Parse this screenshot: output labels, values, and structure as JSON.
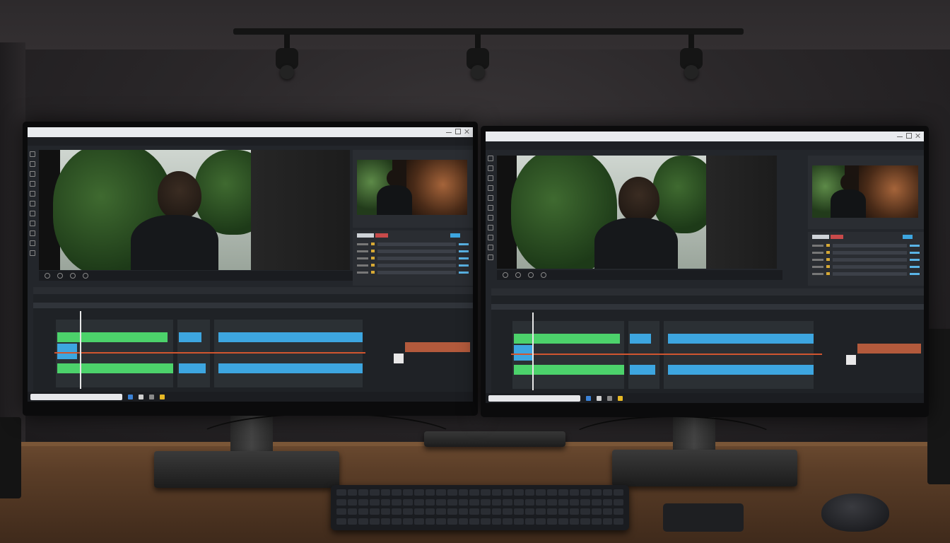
{
  "scene": {
    "description_labels": []
  },
  "monitors": [
    {
      "id": "left",
      "window_title": "",
      "menu": [
        "",
        "",
        "",
        "",
        "",
        ""
      ],
      "panel_tab": "",
      "colors": {
        "green_track": "#4cd26b",
        "blue_track": "#3da6e0",
        "red_line": "#d0552f",
        "accent_yellow": "#d7a935"
      }
    },
    {
      "id": "right",
      "window_title": "",
      "menu": [
        "",
        "",
        "",
        "",
        "",
        ""
      ],
      "panel_tab": "",
      "colors": {
        "green_track": "#4cd26b",
        "blue_track": "#3da6e0",
        "red_line": "#d0552f",
        "accent_yellow": "#d7a935"
      }
    }
  ],
  "icons": {
    "spotlights": "spotlight-icon",
    "tools": "tool-icon",
    "transport": "playback-icon",
    "taskbar": "taskbar-app-icon"
  }
}
